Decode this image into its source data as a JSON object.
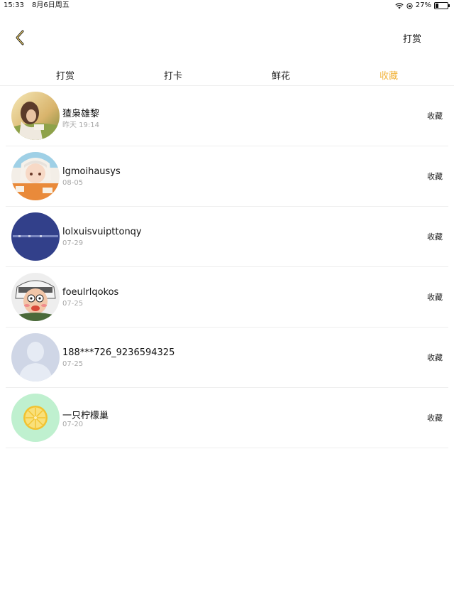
{
  "status_bar": {
    "time": "15:33",
    "date": "8月6日周五",
    "battery": "27%",
    "battery_level": 0.27
  },
  "nav": {
    "back_icon": "chevron-left-icon",
    "action_label": "打赏",
    "accent": "#f1b33b"
  },
  "tabs": [
    {
      "label": "打赏",
      "active": false
    },
    {
      "label": "打卡",
      "active": false
    },
    {
      "label": "鲜花",
      "active": false
    },
    {
      "label": "收藏",
      "active": true
    }
  ],
  "list": [
    {
      "name": "猹枭雄黎",
      "time": "昨天 19:14",
      "action": "收藏",
      "avatar": "photo-avatar"
    },
    {
      "name": "lgmoihausys",
      "time": "08-05",
      "action": "收藏",
      "avatar": "anime-avatar"
    },
    {
      "name": "lolxuisvuipttonqy",
      "time": "07-29",
      "action": "收藏",
      "avatar": "blue-text-avatar"
    },
    {
      "name": "foeulrlqokos",
      "time": "07-25",
      "action": "收藏",
      "avatar": "cartoon-avatar"
    },
    {
      "name": "188***726_9236594325",
      "time": "07-25",
      "action": "收藏",
      "avatar": "default-avatar"
    },
    {
      "name": "一只柠檬巢",
      "time": "07-20",
      "action": "收藏",
      "avatar": "lemon-avatar"
    }
  ]
}
